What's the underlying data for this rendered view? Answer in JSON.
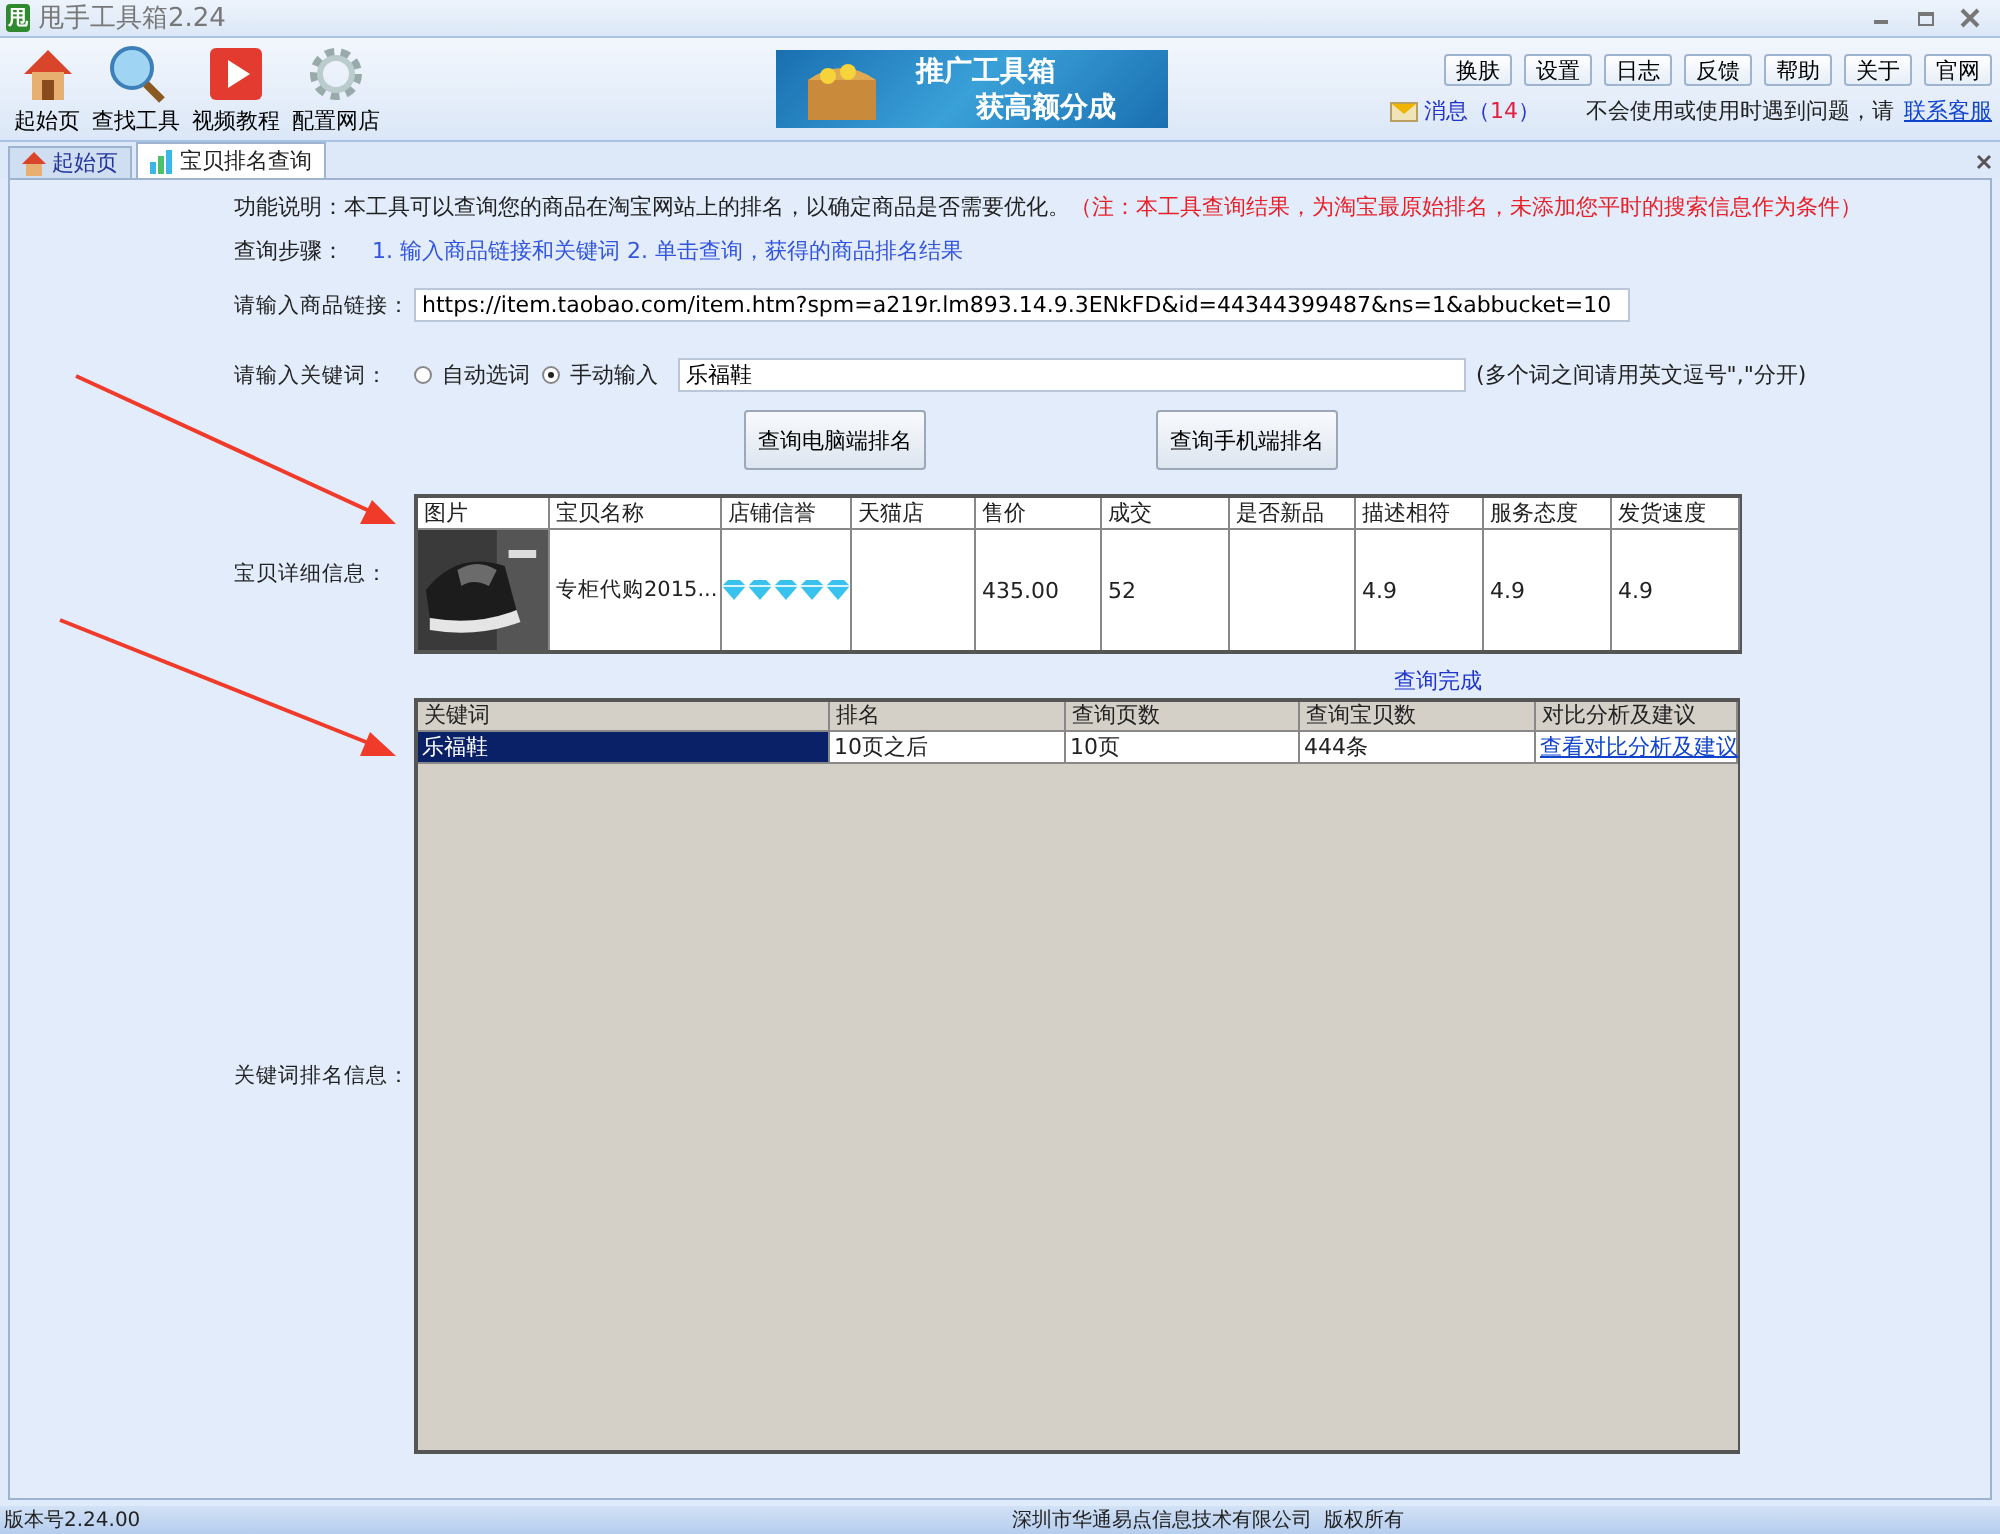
{
  "window": {
    "title": "甩手工具箱",
    "version": "2.24",
    "logo": "甩"
  },
  "toolbar": {
    "tools": [
      {
        "label": "起始页"
      },
      {
        "label": "查找工具"
      },
      {
        "label": "视频教程"
      },
      {
        "label": "配置网店"
      }
    ],
    "banner": {
      "line1": "推广工具箱",
      "line2": "获高额分成"
    },
    "buttons": [
      "换肤",
      "设置",
      "日志",
      "反馈",
      "帮助",
      "关于",
      "官网"
    ],
    "messages": {
      "label": "消息",
      "open": "（",
      "count": "14",
      "close": "）"
    },
    "help": {
      "text": "不会使用或使用时遇到问题，请",
      "link": "联系客服"
    }
  },
  "tabs": [
    {
      "label": "起始页",
      "selected": false
    },
    {
      "label": "宝贝排名查询",
      "selected": true
    }
  ],
  "content": {
    "description": {
      "text": "功能说明：本工具可以查询您的商品在淘宝网站上的排名，以确定商品是否需要优化。",
      "note": "（注：本工具查询结果，为淘宝最原始排名，未添加您平时的搜索信息作为条件）"
    },
    "steps": {
      "label": "查询步骤：",
      "text": "1. 输入商品链接和关键词 2. 单击查询，获得的商品排名结果"
    },
    "url": {
      "label": "请输入商品链接：",
      "value": "https://item.taobao.com/item.htm?spm=a219r.lm893.14.9.3ENkFD&id=44344399487&ns=1&abbucket=10"
    },
    "keyword": {
      "label": "请输入关键词：",
      "options": [
        {
          "label": "自动选词",
          "selected": false
        },
        {
          "label": "手动输入",
          "selected": true
        }
      ],
      "value": "乐福鞋",
      "hint": "(多个词之间请用英文逗号\",\"分开)"
    },
    "buttons": [
      "查询电脑端排名",
      "查询手机端排名"
    ],
    "detail": {
      "label": "宝贝详细信息：",
      "columns": [
        "图片",
        "宝贝名称",
        "店铺信誉",
        "天猫店",
        "售价",
        "成交",
        "是否新品",
        "描述相符",
        "服务态度",
        "发货速度"
      ],
      "rows": [
        {
          "name": "专柜代购2015...",
          "stars": 5,
          "price": "435.00",
          "sales": "52",
          "describe": "4.9",
          "service": "4.9",
          "shipping": "4.9"
        }
      ]
    },
    "status": "查询完成",
    "ranking": {
      "label": "关键词排名信息：",
      "columns": [
        "关键词",
        "排名",
        "查询页数",
        "查询宝贝数",
        "对比分析及建议"
      ],
      "rows": [
        {
          "selected": true,
          "keyword": "乐福鞋",
          "rank": "10页之后",
          "pages": "10页",
          "count": "444条",
          "link": "查看对比分析及建议"
        }
      ]
    }
  },
  "status_bar": {
    "version": "版本号2.24.00",
    "company": "深圳市华通易点信息技术有限公司",
    "rights": "版权所有"
  }
}
